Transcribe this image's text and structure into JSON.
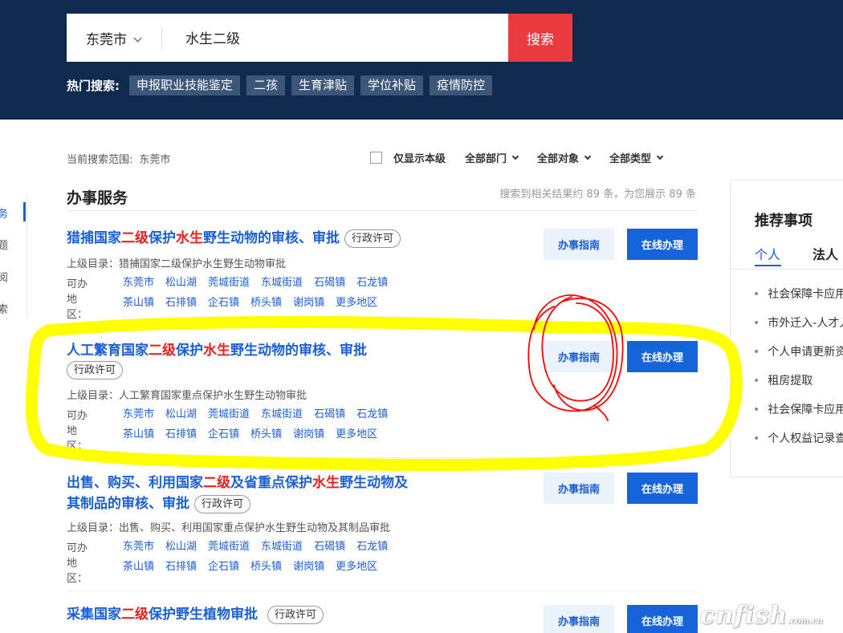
{
  "search": {
    "city": "东莞市",
    "query": "水生二级",
    "button": "搜索",
    "hot_label": "热门搜索:",
    "hot_tags": [
      "申报职业技能鉴定",
      "二孩",
      "生育津贴",
      "学位补贴",
      "疫情防控"
    ]
  },
  "filters": {
    "scope_label": "当前搜索范围:",
    "scope_value": "东莞市",
    "only_level": "仅显示本级",
    "dept": "全部部门",
    "target": "全部对象",
    "type": "全部类型"
  },
  "side_nav": [
    "务",
    "题",
    "阅",
    "索"
  ],
  "section": {
    "title": "办事服务",
    "count_text": "搜索到相关结果约 89 条，为您展示 89 条"
  },
  "items": [
    {
      "title_parts": [
        "猎捕国家",
        "二级",
        "保护",
        "水生",
        "野生动物的审核、审批"
      ],
      "badge": "行政许可",
      "parent": "上级目录：猎捕国家二级保护水生野生动物审批",
      "areas_label": "可办地区：",
      "areas": [
        "东莞市",
        "松山湖",
        "莞城街道",
        "东城街道",
        "石碣镇",
        "石龙镇",
        "茶山镇",
        "石排镇",
        "企石镇",
        "桥头镇",
        "谢岗镇",
        "更多地区"
      ]
    },
    {
      "title_parts": [
        "人工繁育国家",
        "二级",
        "保护",
        "水生",
        "野生动物的审核、审批"
      ],
      "badge": "行政许可",
      "parent": "上级目录：人工繁育国家重点保护水生野生动物审批",
      "areas_label": "可办地区：",
      "areas": [
        "东莞市",
        "松山湖",
        "莞城街道",
        "东城街道",
        "石碣镇",
        "石龙镇",
        "茶山镇",
        "石排镇",
        "企石镇",
        "桥头镇",
        "谢岗镇",
        "更多地区"
      ]
    },
    {
      "title_parts": [
        "出售、购买、利用国家",
        "二级",
        "及省重点保护",
        "水生",
        "野生动物及",
        "其制品的审核、审批"
      ],
      "badge": "行政许可",
      "parent": "上级目录：出售、购买、利用国家重点保护水生野生动物及其制品审批",
      "areas_label": "可办地区：",
      "areas": [
        "东莞市",
        "松山湖",
        "莞城街道",
        "东城街道",
        "石碣镇",
        "石龙镇",
        "茶山镇",
        "石排镇",
        "企石镇",
        "桥头镇",
        "谢岗镇",
        "更多地区"
      ]
    },
    {
      "title_parts": [
        "采集国家",
        "二级",
        "保护野生植物审批"
      ],
      "badge": "行政许可"
    }
  ],
  "buttons": {
    "guide": "办事指南",
    "online": "在线办理"
  },
  "recommend": {
    "title": "推荐事项",
    "tab_personal": "个人",
    "tab_legal": "法人",
    "items": [
      "社会保障卡应用状态",
      "市外迁入-人才入户",
      "个人申请更新资料",
      "租房提取",
      "社会保障卡应用",
      "个人权益记录查询"
    ]
  },
  "watermark": {
    "main": "cnfish",
    "sub": ".com.cn"
  },
  "colors": {
    "header_bg": "#0e2a4e",
    "search_btn": "#e93a3d",
    "link": "#1b5fd4",
    "highlight": "#e8211d",
    "annotation_yellow": "#ffff00",
    "annotation_red": "#ff0000"
  }
}
